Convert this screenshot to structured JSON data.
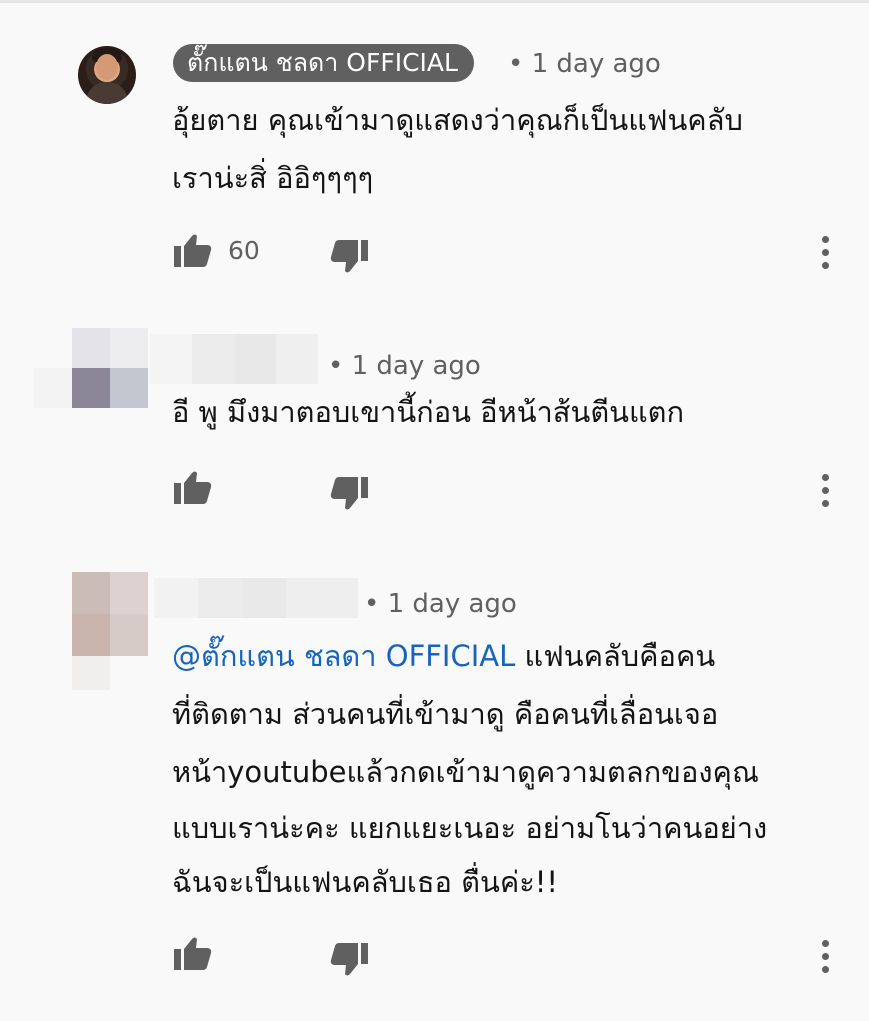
{
  "comments": [
    {
      "author": "ตั๊กแตน ชลดา OFFICIAL",
      "time": "• 1 day ago",
      "lines": [
        "อุ้ยตาย คุณเข้ามาดูแสดงว่าคุณก็เป็นแฟนคลับ",
        "เราน่ะสิ่ อิอิๆๆๆๆ"
      ],
      "likes": "60"
    },
    {
      "time": "• 1 day ago",
      "lines": [
        "อี  พู มึงมาตอบเขานี้ก่อน   อีหน้าส้นตีนแตก"
      ]
    },
    {
      "time": "• 1 day ago",
      "mention": "@ตั๊กแตน ชลดา OFFICIAL",
      "first_line_rest": " แฟนคลับคือคน",
      "lines": [
        "ที่ติดตาม  ส่วนคนที่เข้ามาดู คือคนที่เลื่อนเจอ",
        "หน้าyoutubeแล้วกดเข้ามาดูความตลกของคุณ",
        "แบบเราน่ะคะ แยกแยะเนอะ อย่ามโนว่าคนอย่าง",
        "ฉันจะเป็นแฟนคลับเธอ ตื่นค่ะ!!"
      ]
    }
  ],
  "icons": {
    "like": "thumbs-up-icon",
    "dislike": "thumbs-down-icon",
    "more": "more-vert-icon"
  },
  "colors": {
    "background": "#f9f9f9",
    "owner_chip": "#606060",
    "secondary_text": "#606060",
    "mention": "#1565c0"
  }
}
